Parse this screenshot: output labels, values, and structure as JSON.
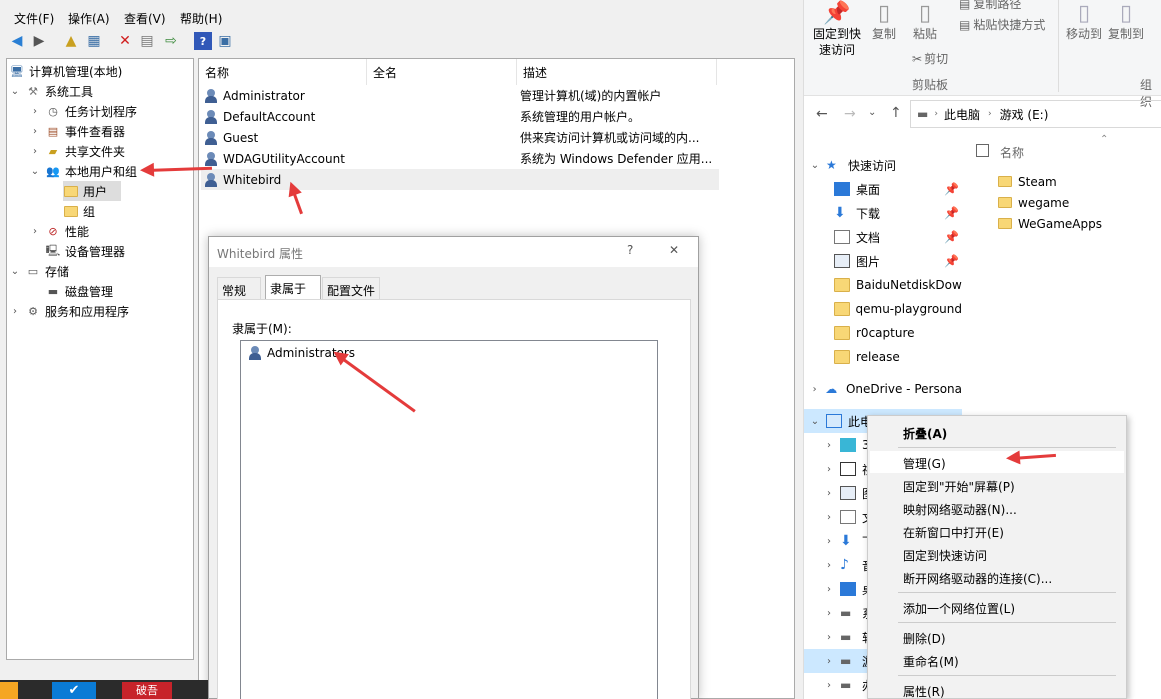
{
  "menubar": {
    "file": "文件(F)",
    "action": "操作(A)",
    "view": "查看(V)",
    "help": "帮助(H)"
  },
  "tree": {
    "root": "计算机管理(本地)",
    "system_tools": "系统工具",
    "task_scheduler": "任务计划程序",
    "event_viewer": "事件查看器",
    "shared_folders": "共享文件夹",
    "local_users_groups": "本地用户和组",
    "users": "用户",
    "groups": "组",
    "performance": "性能",
    "device_manager": "设备管理器",
    "storage": "存储",
    "disk_management": "磁盘管理",
    "services_apps": "服务和应用程序"
  },
  "list": {
    "headers": [
      "名称",
      "全名",
      "描述"
    ],
    "rows": [
      {
        "name": "Administrator",
        "full": "",
        "desc": "管理计算机(域)的内置帐户"
      },
      {
        "name": "DefaultAccount",
        "full": "",
        "desc": "系统管理的用户帐户。"
      },
      {
        "name": "Guest",
        "full": "",
        "desc": "供来宾访问计算机或访问域的内..."
      },
      {
        "name": "WDAGUtilityAccount",
        "full": "",
        "desc": "系统为 Windows Defender 应用..."
      },
      {
        "name": "Whitebird",
        "full": "",
        "desc": ""
      }
    ]
  },
  "dialog": {
    "title": "Whitebird 属性",
    "help": "?",
    "close": "✕",
    "tabs": [
      "常规",
      "隶属于",
      "配置文件"
    ],
    "member_of_label": "隶属于(M):",
    "members": [
      "Administrators"
    ]
  },
  "ribbon": {
    "pin": "固定到快\n速访问",
    "copy": "复制",
    "paste": "粘贴",
    "cut": "剪切",
    "copy_path": "复制路径",
    "paste_shortcut": "粘贴快捷方式",
    "clipboard_group": "剪贴板",
    "move_to": "移动到",
    "copy_to": "复制到",
    "organize_group": "组织"
  },
  "address": {
    "this_pc": "此电脑",
    "drive": "游戏 (E:)"
  },
  "nav": {
    "quick_access": "快速访问",
    "pinned": [
      "桌面",
      "下载",
      "文档",
      "图片"
    ],
    "folders": [
      "BaiduNetdiskDow",
      "qemu-playground",
      "r0capture",
      "release"
    ],
    "onedrive": "OneDrive - Persona",
    "this_pc": "此电",
    "pc_children": [
      "3D",
      "视",
      "图",
      "文",
      "下",
      "音",
      "桌",
      "系",
      "软",
      "游",
      "办"
    ]
  },
  "files": {
    "header": "名称",
    "items": [
      "Steam",
      "wegame",
      "WeGameApps"
    ]
  },
  "context_menu": {
    "collapse": "折叠(A)",
    "manage": "管理(G)",
    "pin_start": "固定到\"开始\"屏幕(P)",
    "map_drive": "映射网络驱动器(N)...",
    "open_new_window": "在新窗口中打开(E)",
    "pin_quick": "固定到快速访问",
    "disconnect": "断开网络驱动器的连接(C)...",
    "add_network": "添加一个网络位置(L)",
    "delete": "删除(D)",
    "rename": "重命名(M)",
    "properties": "属性(R)"
  },
  "taskbar": {
    "app_label": "破吾"
  },
  "colors": {
    "annotation_arrow": "#e43b3b",
    "selection": "#cce8ff",
    "folder": "#f8d776"
  }
}
